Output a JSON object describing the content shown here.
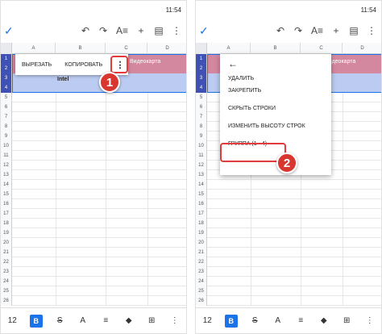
{
  "status_time": "11:54",
  "toolbar": {
    "confirm_icon": "check-icon",
    "undo": "↶",
    "redo": "↷",
    "text_format": "A≡",
    "add": "+",
    "comment": "▤",
    "more": "⋮"
  },
  "columns": [
    "A",
    "B",
    "C",
    "D"
  ],
  "rows": [
    "1",
    "2",
    "3",
    "4",
    "5",
    "6",
    "7",
    "8",
    "9",
    "10",
    "11",
    "12",
    "13",
    "14",
    "15",
    "16",
    "17",
    "18",
    "19",
    "20",
    "21",
    "22",
    "23",
    "24",
    "25",
    "26"
  ],
  "cells": {
    "videocard": "Видеокарта",
    "intel": "Intel"
  },
  "left_context_bar": {
    "cut": "ВЫРЕЗАТЬ",
    "copy": "КОПИРОВАТЬ",
    "more": "⋮"
  },
  "right_menu": {
    "back": "←",
    "items": [
      "УДАЛИТЬ",
      "ЗАКРЕПИТЬ",
      "СКРЫТЬ СТРОКИ",
      "ИЗМЕНИТЬ ВЫСОТУ СТРОК",
      "ГРУППА (1 - 4)"
    ]
  },
  "badges": {
    "step1": "1",
    "step2": "2"
  },
  "bottom": {
    "font_size": "12",
    "bold": "B",
    "strike": "S",
    "text_color": "A",
    "align": "≡",
    "fill": "◆",
    "insert": "⊞",
    "more": "⋮"
  },
  "colors": {
    "accent": "#1a73e8",
    "header_pink": "#e48a9b",
    "badge_red": "#d8372f"
  }
}
